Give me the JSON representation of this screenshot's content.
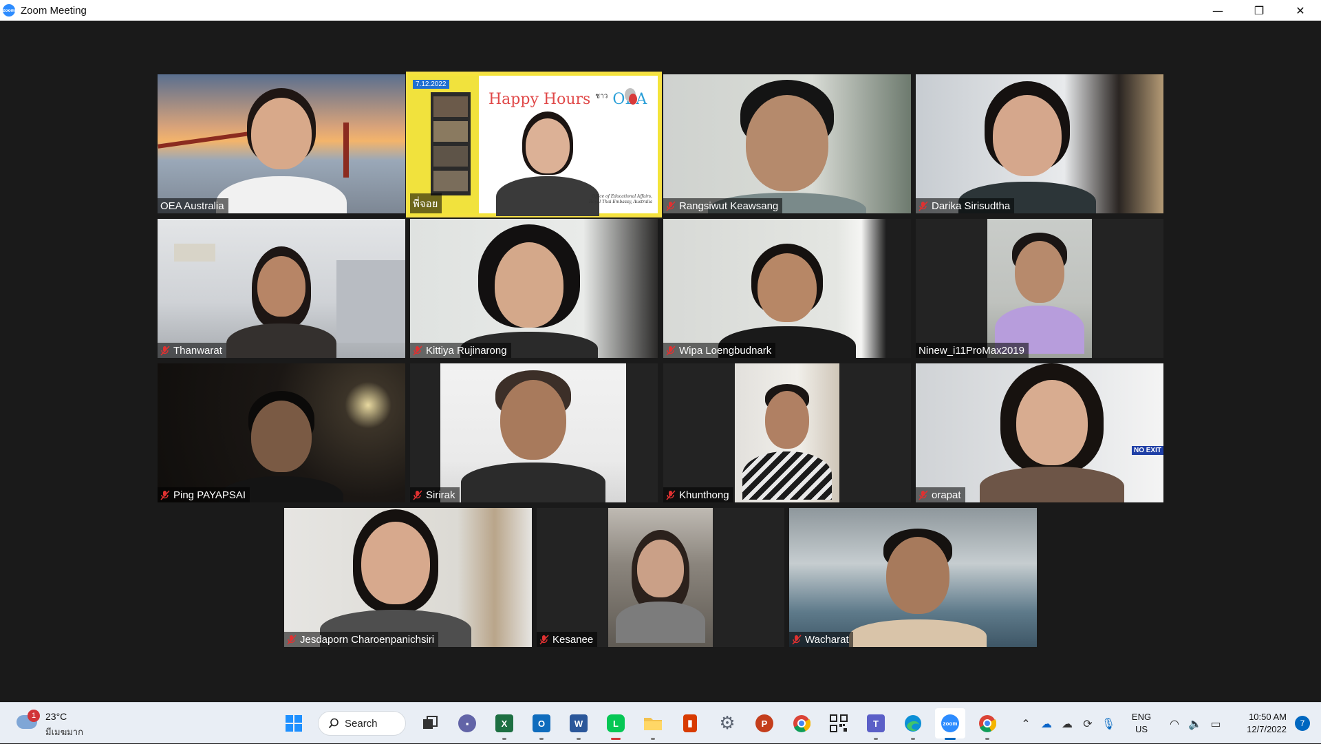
{
  "window": {
    "title": "Zoom Meeting",
    "app_icon_text": "zoom",
    "minimize": "—",
    "restore": "❐",
    "close": "✕"
  },
  "participants": [
    {
      "name": "OEA Australia",
      "muted": false
    },
    {
      "name": "พี่จอย",
      "muted": false,
      "active_speaker": true
    },
    {
      "name": "Rangsiwut Keawsang",
      "muted": true
    },
    {
      "name": "Darika Sirisudtha",
      "muted": true
    },
    {
      "name": "Thanwarat",
      "muted": true
    },
    {
      "name": "Kittiya Rujinarong",
      "muted": true
    },
    {
      "name": "Wipa Loengbudnark",
      "muted": true
    },
    {
      "name": "Ninew_i11ProMax2019",
      "muted": false
    },
    {
      "name": "Ping PAYAPSAI",
      "muted": true
    },
    {
      "name": "Sirirak",
      "muted": true
    },
    {
      "name": "Khunthong",
      "muted": true
    },
    {
      "name": "orapat",
      "muted": true
    },
    {
      "name": "Jesdaporn Charoenpanichsiri",
      "muted": true
    },
    {
      "name": "Kesanee",
      "muted": true
    },
    {
      "name": "Wacharat",
      "muted": true
    }
  ],
  "shared_slide": {
    "date": "7.12.2022",
    "title_part1": "Happy Hours",
    "title_small": "ชาว",
    "title_part2": "OEA",
    "footer_line1": "Office of Educational Affairs,",
    "footer_line2": "Royal Thai Embassy, Australia",
    "no_exit_sign": "NO EXIT"
  },
  "taskbar": {
    "weather": {
      "badge": "1",
      "temp": "23°C",
      "condition": "มีเมฆมาก"
    },
    "search_label": "Search",
    "apps": [
      {
        "name": "start",
        "icon": "windows-icon",
        "color": "#1e90ff"
      },
      {
        "name": "search",
        "icon": "search-icon"
      },
      {
        "name": "task-view",
        "icon": "task-view-icon",
        "color": "#333333"
      },
      {
        "name": "teams-chat",
        "icon": "chat-icon",
        "color": "#6264a7"
      },
      {
        "name": "excel",
        "icon": "excel-icon",
        "color": "#1d6f42",
        "letter": "X"
      },
      {
        "name": "outlook",
        "icon": "outlook-icon",
        "color": "#0f6cbd",
        "letter": "O"
      },
      {
        "name": "word",
        "icon": "word-icon",
        "color": "#2b579a",
        "letter": "W"
      },
      {
        "name": "line",
        "icon": "line-icon",
        "color": "#06c755",
        "letter": "L"
      },
      {
        "name": "file-explorer",
        "icon": "folder-icon",
        "color": "#f2c14e"
      },
      {
        "name": "office",
        "icon": "office-icon",
        "color": "#d83b01"
      },
      {
        "name": "settings",
        "icon": "gear-icon",
        "color": "#5a6270"
      },
      {
        "name": "powerpoint",
        "icon": "powerpoint-icon",
        "color": "#c43e1c",
        "letter": "P"
      },
      {
        "name": "chrome",
        "icon": "chrome-icon",
        "color": "#db4437"
      },
      {
        "name": "qr-app",
        "icon": "qr-icon",
        "color": "#222222"
      },
      {
        "name": "teams",
        "icon": "teams-icon",
        "color": "#5b5fc7",
        "letter": "T"
      },
      {
        "name": "edge",
        "icon": "edge-icon",
        "color": "#0c8fd6"
      },
      {
        "name": "zoom",
        "icon": "zoom-icon",
        "color": "#2d8cff"
      },
      {
        "name": "chrome-profile",
        "icon": "chrome-icon",
        "color": "#0f9d58"
      }
    ],
    "tray": {
      "lang_line1": "ENG",
      "lang_line2": "US",
      "time": "10:50 AM",
      "date": "12/7/2022",
      "notifications": "7"
    }
  }
}
